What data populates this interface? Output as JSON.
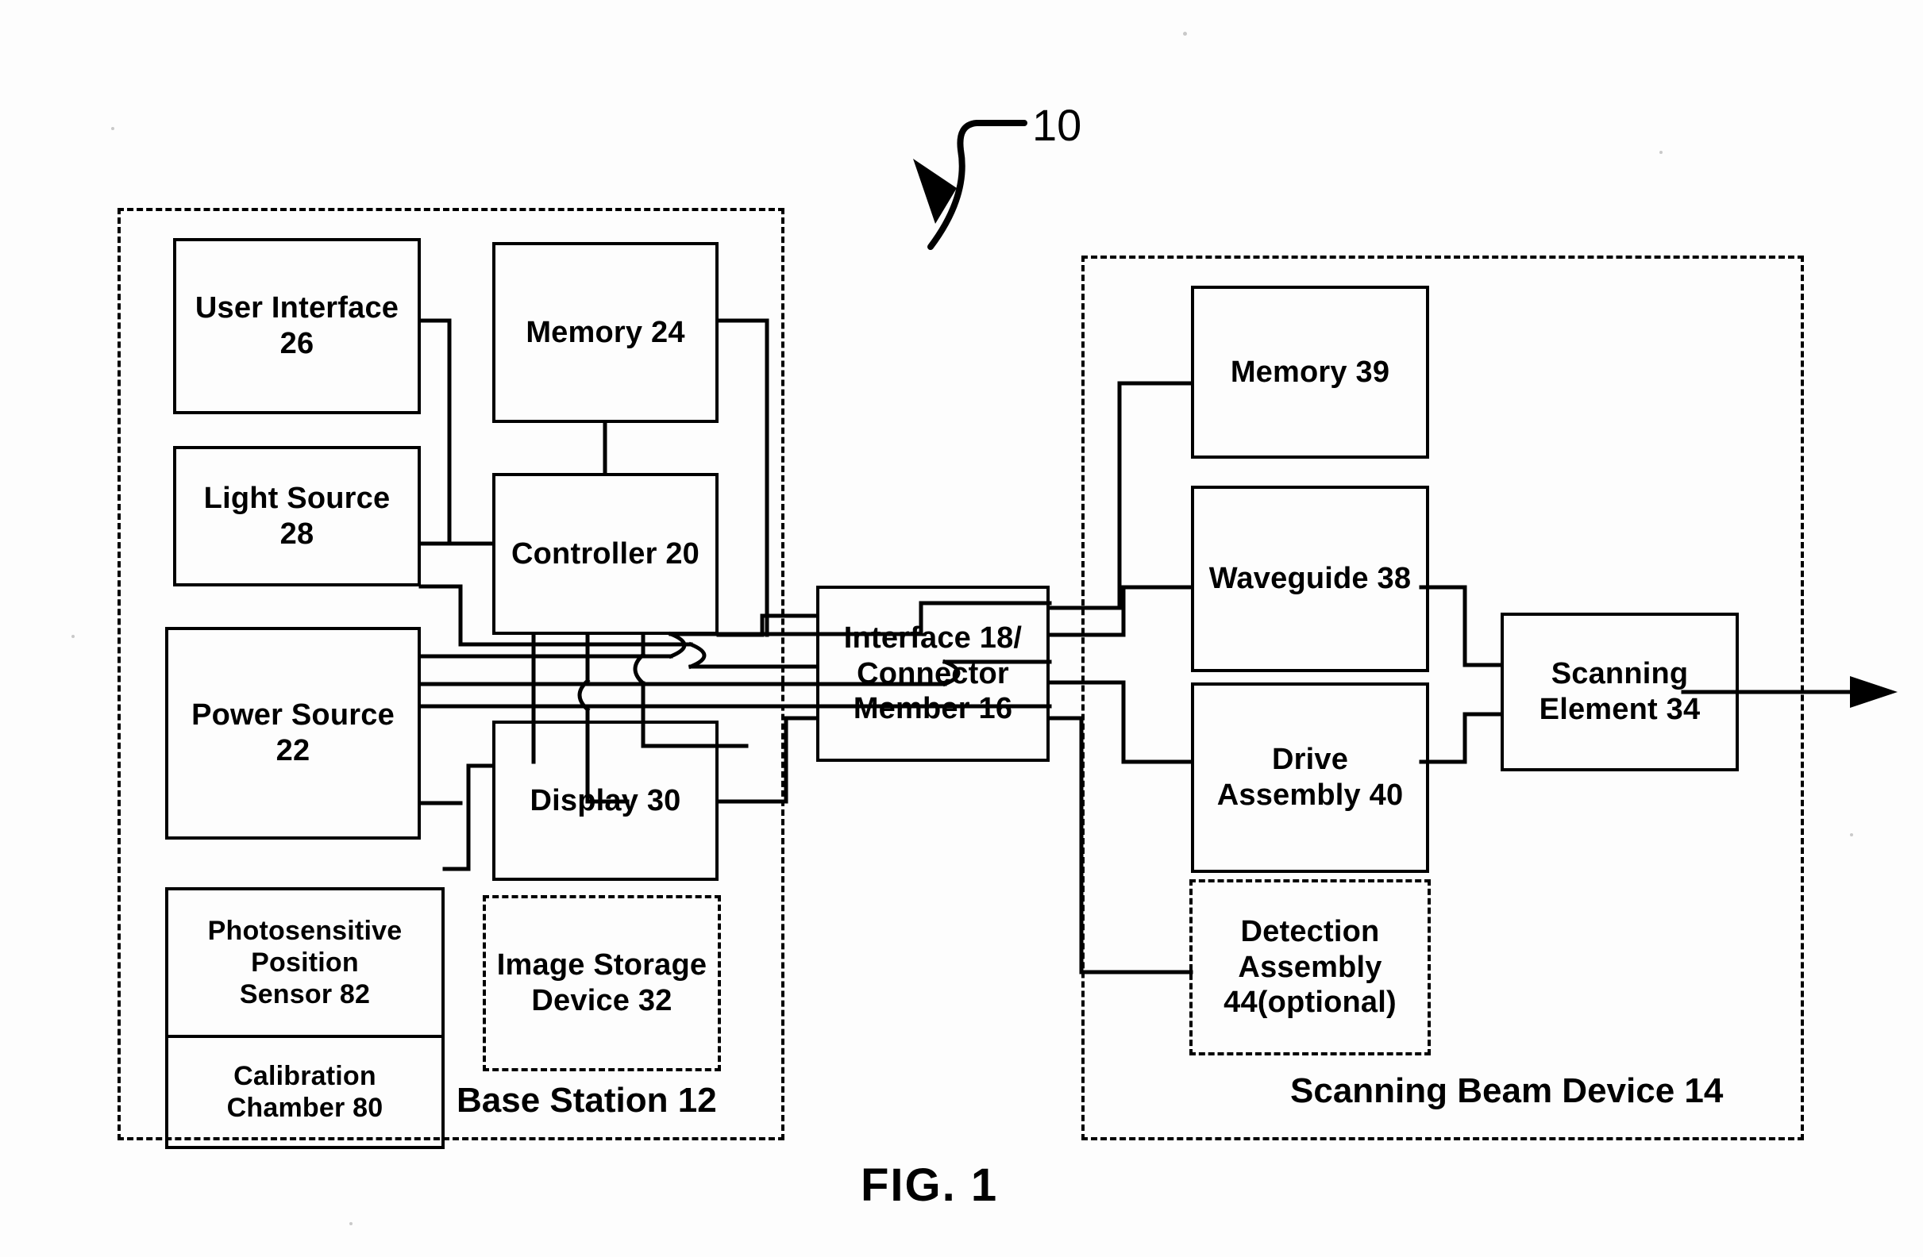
{
  "figure": {
    "caption": "FIG. 1",
    "reference_numeral": "10"
  },
  "groups": [
    {
      "id": "base-station",
      "label": "Base Station 12"
    },
    {
      "id": "scanning-beam-device",
      "label": "Scanning Beam Device 14"
    }
  ],
  "base_station": {
    "label": "Base Station 12",
    "blocks": [
      {
        "id": "user-interface",
        "label": "User Interface\n26",
        "border": "solid"
      },
      {
        "id": "light-source",
        "label": "Light Source\n28",
        "border": "solid"
      },
      {
        "id": "power-source",
        "label": "Power Source\n22",
        "border": "solid"
      },
      {
        "id": "photosensitive-position-sensor",
        "label": "Photosensitive\nPosition\nSensor 82",
        "border": "solid"
      },
      {
        "id": "calibration-chamber",
        "label": "Calibration\nChamber 80",
        "border": "solid"
      },
      {
        "id": "memory-24",
        "label": "Memory 24",
        "border": "solid"
      },
      {
        "id": "controller-20",
        "label": "Controller 20",
        "border": "solid"
      },
      {
        "id": "display-30",
        "label": "Display 30",
        "border": "solid"
      },
      {
        "id": "image-storage-device",
        "label": "Image Storage\nDevice 32",
        "border": "dashed"
      }
    ]
  },
  "interface": {
    "id": "interface-connector-member",
    "label": "Interface 18/\nConnector\nMember 16",
    "border": "solid"
  },
  "scanning_beam_device": {
    "label": "Scanning Beam Device 14",
    "blocks": [
      {
        "id": "memory-39",
        "label": "Memory 39",
        "border": "solid"
      },
      {
        "id": "waveguide-38",
        "label": "Waveguide 38",
        "border": "solid"
      },
      {
        "id": "drive-assembly-40",
        "label": "Drive\nAssembly 40",
        "border": "solid"
      },
      {
        "id": "detection-assembly",
        "label": "Detection\nAssembly\n44(optional)",
        "border": "dashed"
      },
      {
        "id": "scanning-element-34",
        "label": "Scanning\nElement 34",
        "border": "solid"
      }
    ]
  },
  "colors": {
    "ink": "#000000",
    "paper": "#fdfdfd"
  }
}
